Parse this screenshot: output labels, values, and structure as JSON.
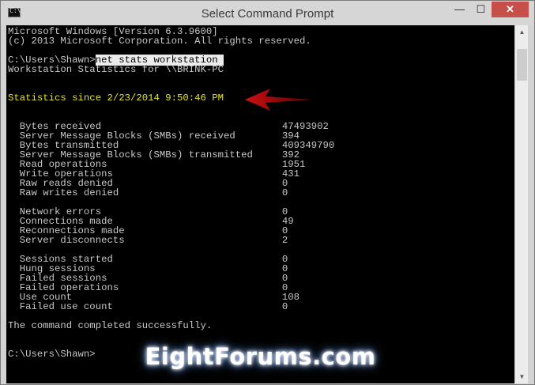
{
  "window": {
    "title": "Select Command Prompt",
    "icon_text": "C:\\",
    "controls": {
      "minimize": "—",
      "maximize": "☐",
      "close": "✕"
    }
  },
  "console": {
    "lines": [
      "Microsoft Windows [Version 6.3.9600]",
      "(c) 2013 Microsoft Corporation. All rights reserved.",
      "",
      "",
      "Workstation Statistics for \\\\BRINK-PC",
      "",
      "",
      "",
      "",
      "",
      "  Bytes received                               47493902",
      "  Server Message Blocks (SMBs) received        394",
      "  Bytes transmitted                            409349790",
      "  Server Message Blocks (SMBs) transmitted     392",
      "  Read operations                              1951",
      "  Write operations                             431",
      "  Raw reads denied                             0",
      "  Raw writes denied                            0",
      "",
      "  Network errors                               0",
      "  Connections made                             49",
      "  Reconnections made                           0",
      "  Server disconnects                           2",
      "",
      "  Sessions started                             0",
      "  Hung sessions                                0",
      "  Failed sessions                              0",
      "  Failed operations                            0",
      "  Use count                                    108",
      "  Failed use count                             0",
      "",
      "The command completed successfully.",
      "",
      "",
      "C:\\Users\\Shawn>"
    ],
    "prompt_line": {
      "prompt": "C:\\Users\\Shawn>",
      "command": "net stats workstation "
    },
    "statistics_line": "Statistics since 2/23/2014 9:50:46 PM",
    "colors": {
      "background": "#000000",
      "text": "#c8c8c8",
      "highlight": "#e6e61a",
      "arrow": "#cc1111"
    }
  },
  "watermark": "EightForums.com",
  "scrollbar": {
    "up_icon": "up-arrow-icon",
    "down_icon": "down-arrow-icon"
  }
}
